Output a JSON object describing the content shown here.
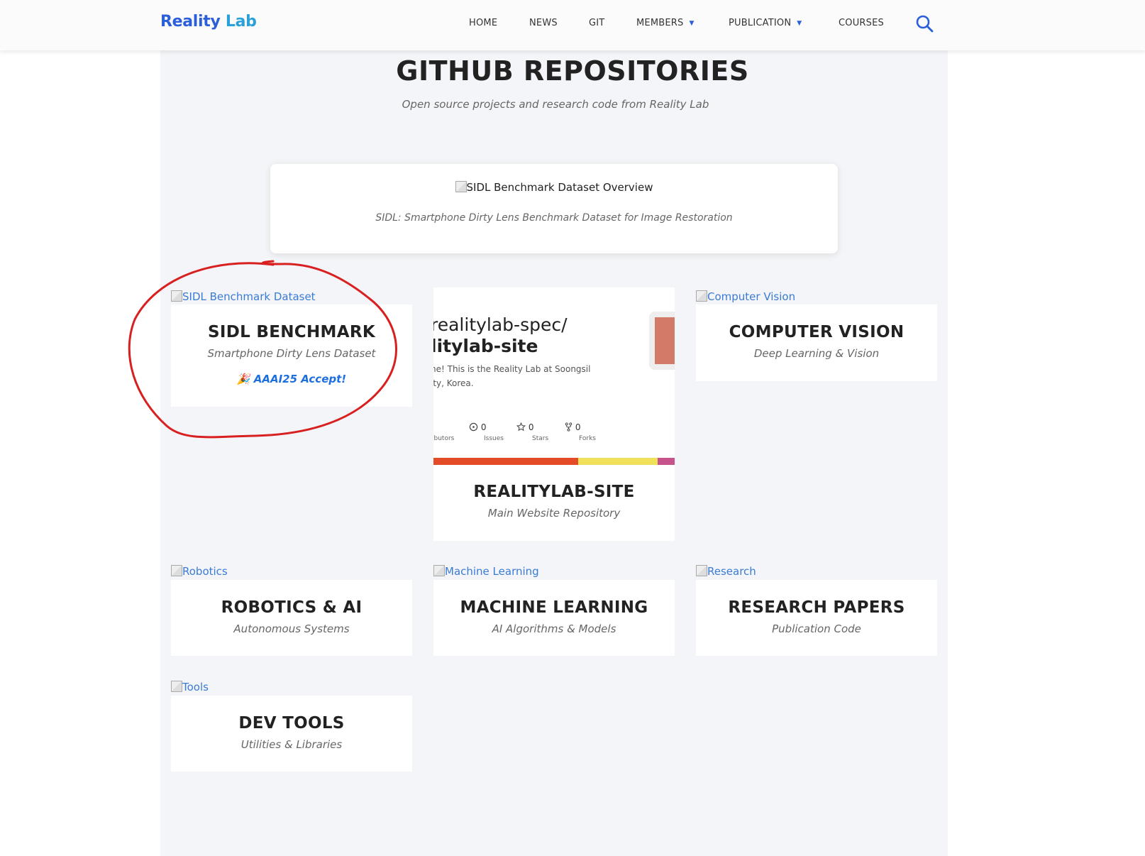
{
  "header": {
    "logo_part1": "Reality",
    "logo_part2": "Lab",
    "nav": [
      {
        "label": "HOME"
      },
      {
        "label": "NEWS"
      },
      {
        "label": "GIT"
      },
      {
        "label": "MEMBERS",
        "dropdown": true
      },
      {
        "label": "PUBLICATION",
        "dropdown": true
      },
      {
        "label": "COURSES"
      }
    ],
    "search_icon": "search-icon"
  },
  "page": {
    "title": "GITHUB REPOSITORIES",
    "subtitle": "Open source projects and research code from Reality Lab"
  },
  "feature": {
    "image_alt": "SIDL Benchmark Dataset Overview",
    "caption": "SIDL: Smartphone Dirty Lens Benchmark Dataset for Image Restoration"
  },
  "repos": {
    "sidl": {
      "image_alt": "SIDL Benchmark Dataset",
      "title": "SIDL BENCHMARK",
      "subtitle": "Smartphone Dirty Lens Dataset",
      "badge": "🎉 AAAI25 Accept!"
    },
    "site": {
      "title": "REALITYLAB-SITE",
      "subtitle": "Main Website Repository",
      "preview": {
        "line1": "realitylab-spec/",
        "line2": "litylab-site",
        "desc1": "ne! This is the Reality Lab at Soongsil",
        "desc2": "ity, Korea.",
        "stats": [
          {
            "value": "",
            "label": "ibutors"
          },
          {
            "value": "0",
            "label": "Issues"
          },
          {
            "value": "0",
            "label": "Stars"
          },
          {
            "value": "0",
            "label": "Forks"
          }
        ],
        "language_colors": [
          "#e34c26",
          "#f1e05a",
          "#c6538c"
        ],
        "language_shares": [
          0.6,
          0.33,
          0.07
        ]
      }
    },
    "cv": {
      "image_alt": "Computer Vision",
      "title": "COMPUTER VISION",
      "subtitle": "Deep Learning & Vision"
    },
    "robotics": {
      "image_alt": "Robotics",
      "title": "ROBOTICS & AI",
      "subtitle": "Autonomous Systems"
    },
    "ml": {
      "image_alt": "Machine Learning",
      "title": "MACHINE LEARNING",
      "subtitle": "AI Algorithms & Models"
    },
    "research": {
      "image_alt": "Research",
      "title": "RESEARCH PAPERS",
      "subtitle": "Publication Code"
    },
    "tools": {
      "image_alt": "Tools",
      "title": "DEV TOOLS",
      "subtitle": "Utilities & Libraries"
    }
  },
  "colors": {
    "accent": "#2b5fd9",
    "badge": "#1d6fe0",
    "annotation": "#d92020"
  }
}
